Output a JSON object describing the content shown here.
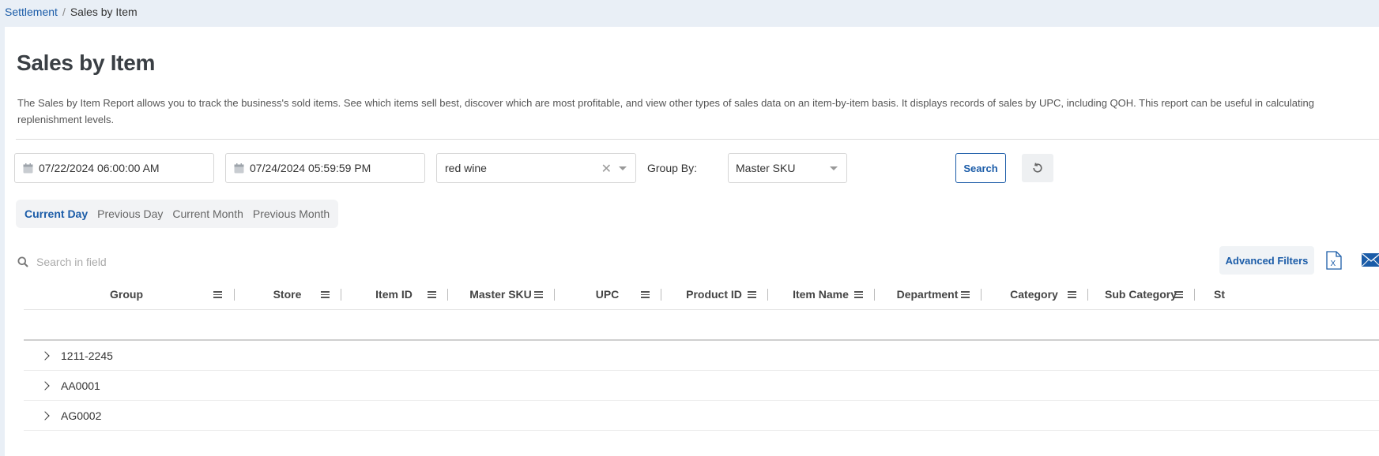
{
  "breadcrumb": {
    "parent": "Settlement",
    "separator": "/",
    "current": "Sales by Item"
  },
  "page": {
    "title": "Sales by Item",
    "description": "The Sales by Item Report allows you to track the business's sold items. See which items sell best, discover which are most profitable, and view other types of sales data on an item-by-item basis. It displays records of sales by UPC, including QOH. This report can be useful in calculating replenishment levels."
  },
  "filters": {
    "start_date": "07/22/2024 06:00:00 AM",
    "end_date": "07/24/2024 05:59:59 PM",
    "item_query": "red wine",
    "clear_glyph": "✕",
    "group_by_label": "Group By:",
    "group_by_value": "Master SKU",
    "search_label": "Search"
  },
  "presets": [
    "Current Day",
    "Previous Day",
    "Current Month",
    "Previous Month"
  ],
  "active_preset": "Current Day",
  "toolbar": {
    "search_placeholder": "Search in field",
    "advanced_filters": "Advanced Filters"
  },
  "table": {
    "columns": [
      "Group",
      "Store",
      "Item ID",
      "Master SKU",
      "UPC",
      "Product ID",
      "Item Name",
      "Department",
      "Category",
      "Sub Category",
      "St"
    ],
    "rows": [
      "1211-2245",
      "AA0001",
      "AG0002"
    ]
  },
  "colors": {
    "accent": "#1b5ca8",
    "background": "#e9eff6",
    "excel_icon": "#1b5ca8",
    "mail_icon": "#1b5ca8"
  },
  "icons": [
    "calendar-icon",
    "clear-icon",
    "caret-down-icon",
    "reset-icon",
    "search-icon",
    "excel-export-icon",
    "email-icon",
    "column-menu-icon",
    "expand-chevron-icon"
  ]
}
